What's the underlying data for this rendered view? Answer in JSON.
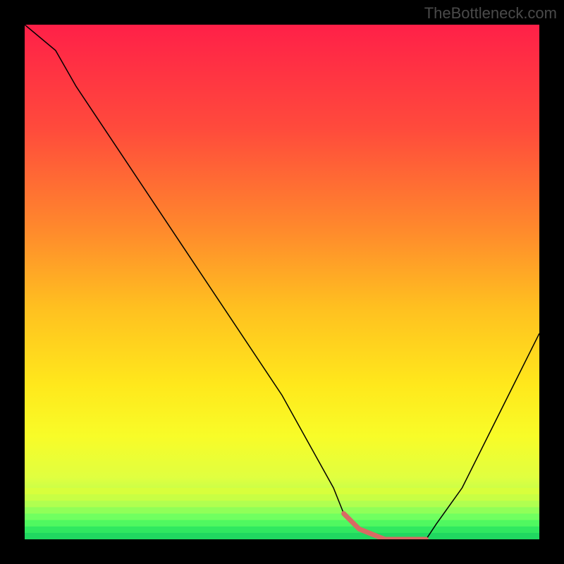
{
  "watermark": "TheBottleneck.com",
  "chart_data": {
    "type": "line",
    "title": "",
    "xlabel": "",
    "ylabel": "",
    "xlim": [
      0,
      100
    ],
    "ylim": [
      0,
      100
    ],
    "grid": false,
    "series": [
      {
        "name": "curve",
        "x": [
          0,
          6,
          10,
          20,
          30,
          40,
          50,
          60,
          62,
          65,
          70,
          75,
          78,
          80,
          85,
          90,
          95,
          100
        ],
        "values": [
          100,
          95,
          88,
          73,
          58,
          43,
          28,
          10,
          5,
          2,
          0,
          0,
          0,
          3,
          10,
          20,
          30,
          40
        ]
      }
    ],
    "highlight": {
      "x": [
        62,
        65,
        70,
        75,
        78
      ],
      "values": [
        5,
        2,
        0,
        0,
        0
      ]
    },
    "background_gradient": {
      "stops": [
        {
          "offset": 0.0,
          "color": "#ff2048"
        },
        {
          "offset": 0.2,
          "color": "#ff4a3c"
        },
        {
          "offset": 0.4,
          "color": "#ff8a2c"
        },
        {
          "offset": 0.55,
          "color": "#ffc020"
        },
        {
          "offset": 0.7,
          "color": "#ffe81c"
        },
        {
          "offset": 0.8,
          "color": "#f8fc28"
        },
        {
          "offset": 0.88,
          "color": "#e0ff40"
        },
        {
          "offset": 0.93,
          "color": "#b0ff50"
        },
        {
          "offset": 0.97,
          "color": "#60f860"
        },
        {
          "offset": 1.0,
          "color": "#20d860"
        }
      ]
    },
    "baseline_stripes": {
      "start": 0.9,
      "count": 8,
      "colors": [
        "#d8ff3c",
        "#c8ff44",
        "#b0ff50",
        "#90ff58",
        "#70ff60",
        "#50f860",
        "#30e860",
        "#20d860"
      ]
    }
  }
}
